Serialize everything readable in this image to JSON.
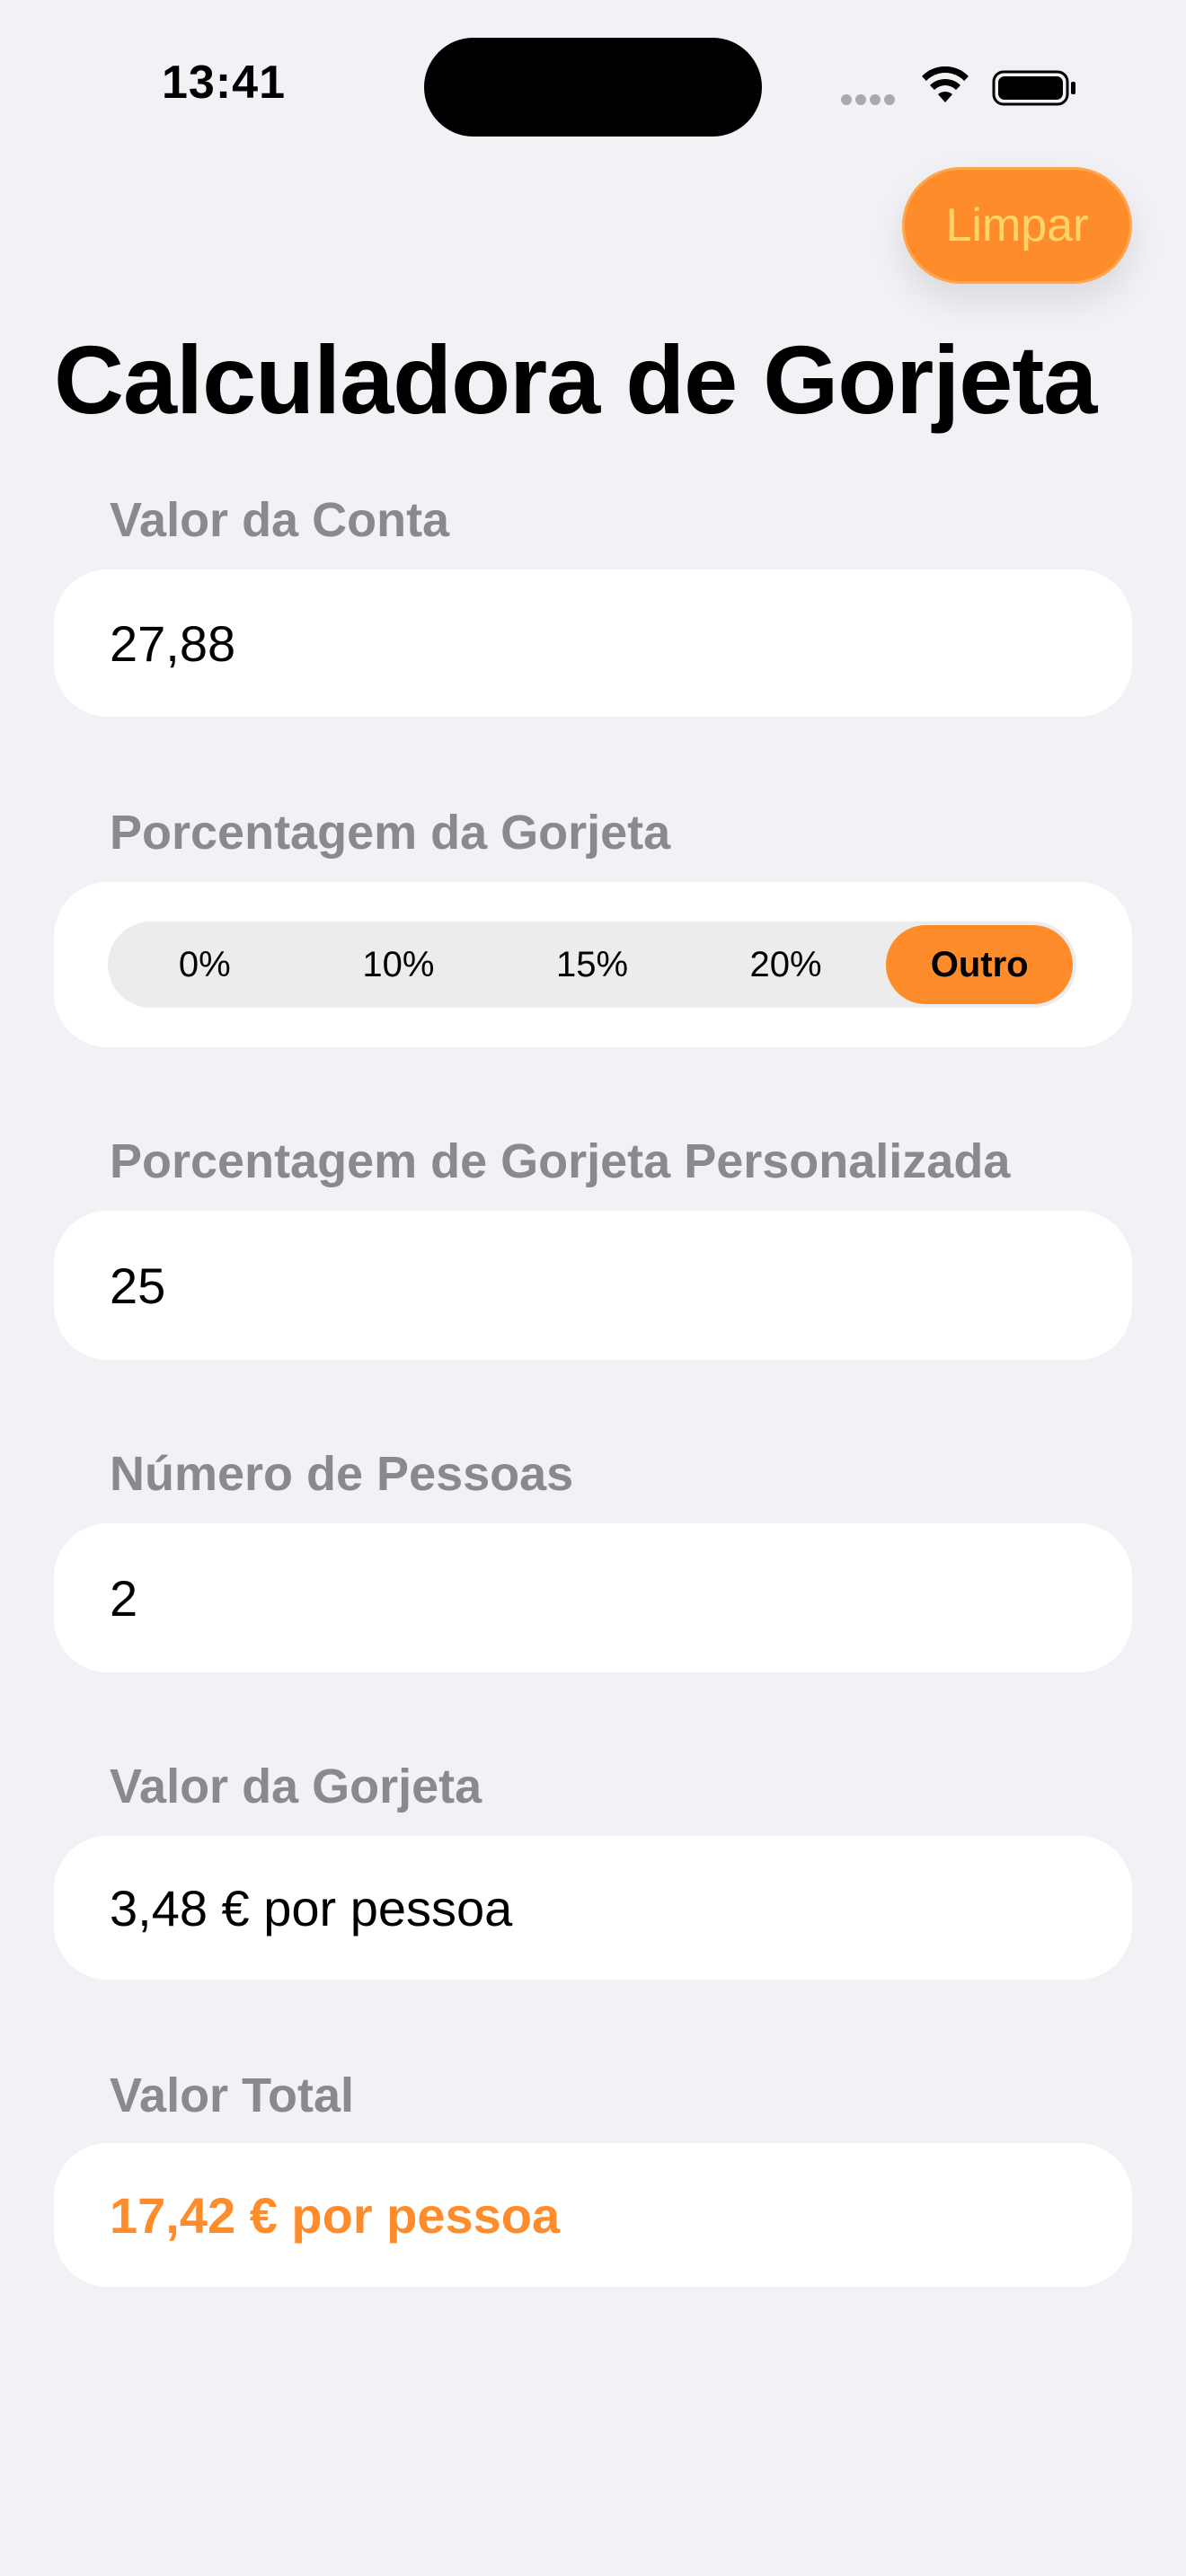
{
  "status_bar": {
    "time": "13:41"
  },
  "toolbar": {
    "clear_label": "Limpar"
  },
  "page": {
    "title": "Calculadora de Gorjeta"
  },
  "bill": {
    "label": "Valor da Conta",
    "value": "27,88"
  },
  "tip_percentage": {
    "label": "Porcentagem da Gorjeta",
    "options": [
      "0%",
      "10%",
      "15%",
      "20%",
      "Outro"
    ],
    "selected": "Outro"
  },
  "custom_tip": {
    "label": "Porcentagem de Gorjeta Personalizada",
    "value": "25"
  },
  "people": {
    "label": "Número de Pessoas",
    "value": "2"
  },
  "tip_amount": {
    "label": "Valor da Gorjeta",
    "value": "3,48 € por pessoa"
  },
  "total": {
    "label": "Valor Total",
    "value": "17,42 € por pessoa"
  },
  "colors": {
    "accent": "#FF8C2B",
    "background": "#F2F1F6",
    "label_gray": "#8A8A8E"
  }
}
